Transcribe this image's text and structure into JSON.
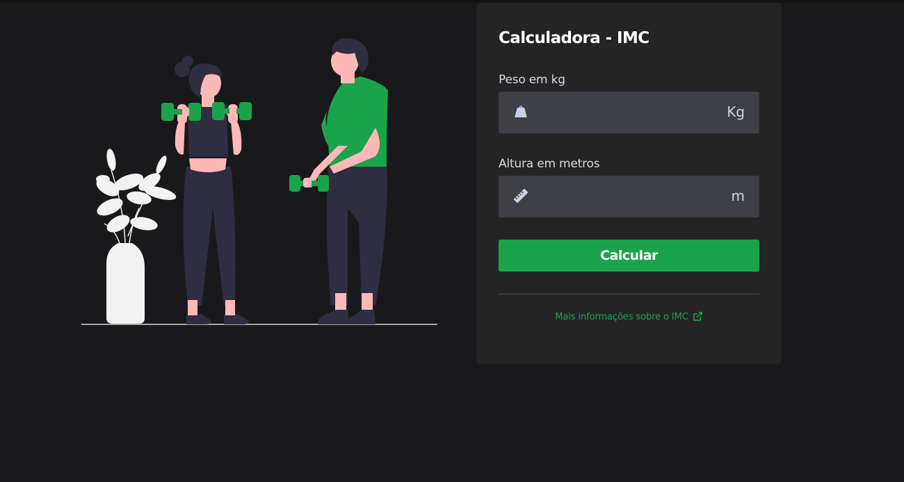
{
  "card": {
    "title": "Calculadora - IMC",
    "weight": {
      "label": "Peso em kg",
      "value": "",
      "placeholder": "",
      "unit": "Kg",
      "icon": "weight-icon"
    },
    "height": {
      "label": "Altura em metros",
      "value": "",
      "placeholder": "",
      "unit": "m",
      "icon": "ruler-icon"
    },
    "button_label": "Calcular",
    "info_link_label": "Mais informações sobre o IMC",
    "info_link_icon": "external-link-icon"
  },
  "colors": {
    "background": "#19191b",
    "card": "#242425",
    "input": "#3f3f46",
    "accent": "#1aa34a",
    "skin": "#ffb8b8",
    "dark_clothing": "#2f2e41",
    "plant": "#f2f2f2"
  }
}
